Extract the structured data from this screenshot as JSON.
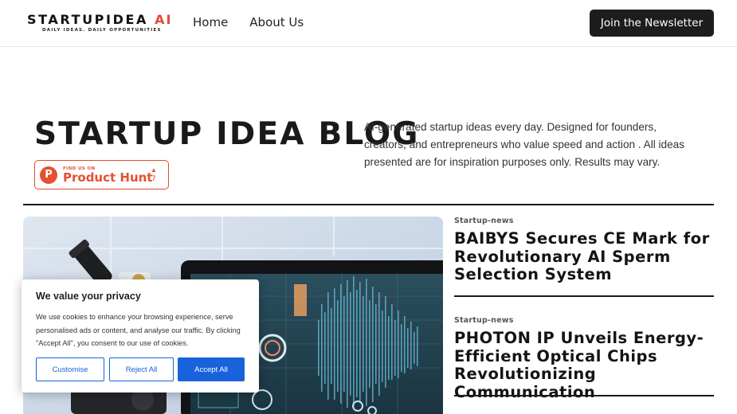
{
  "header": {
    "logo_text": "STARTUPIDEA",
    "logo_ai": "AI",
    "logo_tagline": "DAILY IDEAS. DAILY OPPORTUNITIES",
    "nav": [
      {
        "label": "Home"
      },
      {
        "label": "About Us"
      }
    ],
    "newsletter_label": "Join the Newsletter"
  },
  "hero": {
    "title": "STARTUP IDEA BLOG",
    "description": "AI-generated startup ideas every day. Designed for founders, creators, and entrepreneurs who value speed and action . All ideas presented are for inspiration purposes only. Results may vary.",
    "product_hunt": {
      "letter": "P",
      "small_text": "FIND US ON",
      "big_text": "Product Hunt",
      "count": "7"
    }
  },
  "articles": [
    {
      "category": "Startup-news",
      "title": "BAIBYS Secures CE Mark for Revolutionary AI Sperm Selection System"
    },
    {
      "category": "Startup-news",
      "title": "PHOTON IP Unveils Energy-Efficient Optical Chips Revolutionizing Communication"
    }
  ],
  "cookie_banner": {
    "title": "We value your privacy",
    "text": "We use cookies to enhance your browsing experience, serve personalised ads or content, and analyse our traffic. By clicking \"Accept All\", you consent to our use of cookies.",
    "customise_label": "Customise",
    "reject_label": "Reject All",
    "accept_label": "Accept All"
  },
  "colors": {
    "accent_red": "#e34a3a",
    "product_hunt": "#e5502f",
    "cookie_blue": "#1863dc",
    "dark_button": "#1d1d1d"
  }
}
